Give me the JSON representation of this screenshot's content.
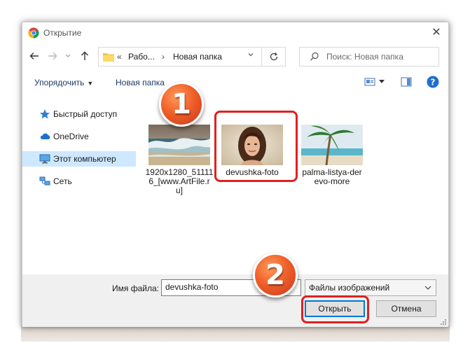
{
  "window": {
    "title": "Открытие",
    "close_label": "✕"
  },
  "navigation": {
    "back_icon": "arrow-left-icon",
    "forward_icon": "arrow-right-icon",
    "recent_icon": "chevron-down-icon",
    "up_icon": "arrow-up-icon",
    "address": {
      "overflow": "«",
      "crumbs": [
        "Рабо...",
        "Новая папка"
      ],
      "separator": "›"
    },
    "search_placeholder": "Поиск: Новая папка"
  },
  "toolbar": {
    "organize_label": "Упорядочить",
    "new_folder_label": "Новая папка"
  },
  "sidebar": {
    "items": [
      {
        "label": "Быстрый доступ",
        "icon": "star-icon",
        "selected": false
      },
      {
        "label": "OneDrive",
        "icon": "cloud-icon",
        "selected": false
      },
      {
        "label": "Этот компьютер",
        "icon": "computer-icon",
        "selected": true
      },
      {
        "label": "Сеть",
        "icon": "network-icon",
        "selected": false
      }
    ]
  },
  "files": [
    {
      "name": "1920x1280_511116_[www.ArtFile.ru]",
      "name_lines": [
        "1920x1280_51111",
        "6_[www.ArtFile.r",
        "u]"
      ],
      "thumb": "waves-thumbnail"
    },
    {
      "name": "devushka-foto",
      "name_lines": [
        "devushka-foto"
      ],
      "thumb": "portrait-thumbnail"
    },
    {
      "name": "palma-listya-derevo-more",
      "name_lines": [
        "palma-listya-der",
        "evo-more"
      ],
      "thumb": "palm-thumbnail"
    }
  ],
  "footer": {
    "filename_label": "Имя файла:",
    "filename_value": "devushka-foto",
    "filter_value": "Файлы изображений",
    "open_label": "Открыть",
    "cancel_label": "Отмена"
  },
  "annotations": {
    "step1": "1",
    "step2": "2",
    "highlight_color": "#e02020",
    "badge_color": "#f0602a"
  }
}
